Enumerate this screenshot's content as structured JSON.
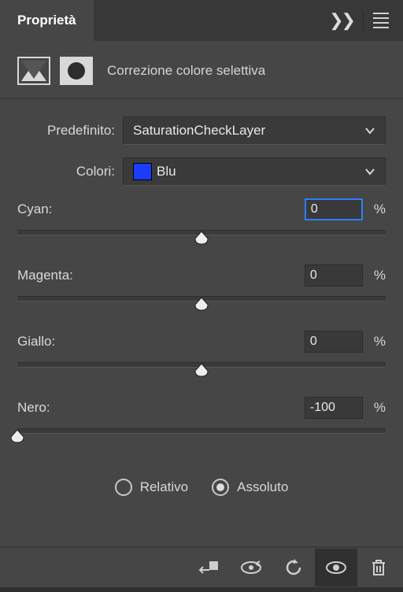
{
  "panel": {
    "tab_title": "Proprietà",
    "adjustment_title": "Correzione colore selettiva"
  },
  "preset": {
    "label": "Predefinito:",
    "value": "SaturationCheckLayer"
  },
  "colors": {
    "label": "Colori:",
    "value": "Blu",
    "swatch": "#1a3cff"
  },
  "sliders": {
    "cyan": {
      "label": "Cyan:",
      "value": "0",
      "percent_pos": 50
    },
    "magenta": {
      "label": "Magenta:",
      "value": "0",
      "percent_pos": 50
    },
    "yellow": {
      "label": "Giallo:",
      "value": "0",
      "percent_pos": 50
    },
    "black": {
      "label": "Nero:",
      "value": "-100",
      "percent_pos": 0
    }
  },
  "percent_sign": "%",
  "method": {
    "relative_label": "Relativo",
    "absolute_label": "Assoluto",
    "selected": "absolute"
  }
}
